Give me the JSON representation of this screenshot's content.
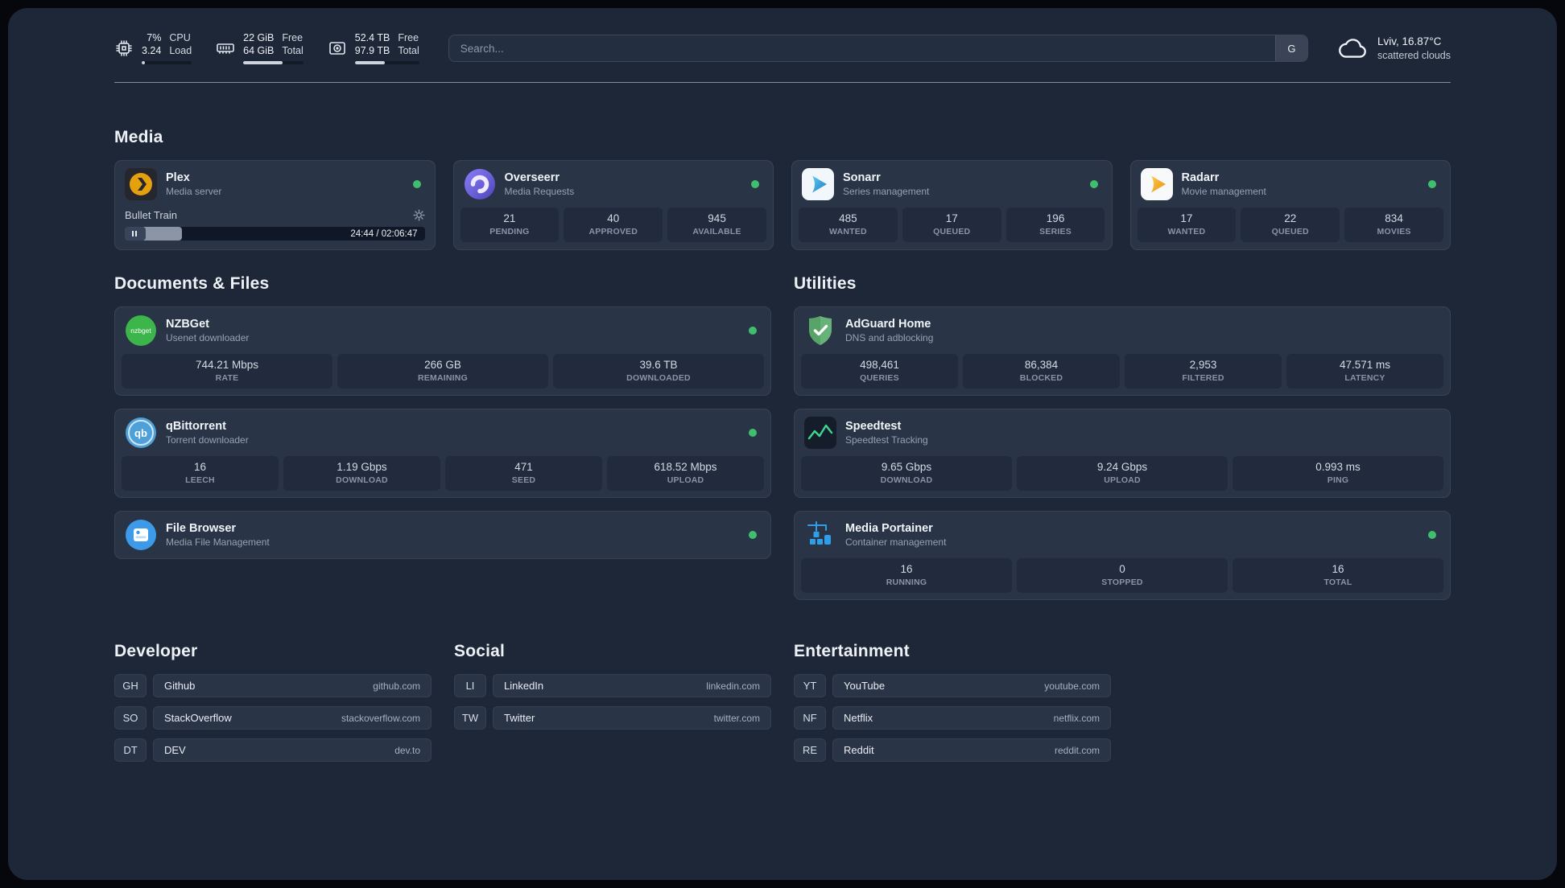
{
  "colors": {
    "status_online": "#3fbf6e",
    "accent_fill": "#cdd4de"
  },
  "topbar": {
    "cpu": {
      "icon": "cpu-icon",
      "values": [
        "7%",
        "3.24"
      ],
      "labels": [
        "CPU",
        "Load"
      ],
      "progress_pct": 7
    },
    "memory": {
      "icon": "memory-icon",
      "values": [
        "22 GiB",
        "64 GiB"
      ],
      "labels": [
        "Free",
        "Total"
      ],
      "progress_pct": 66
    },
    "disk": {
      "icon": "disk-icon",
      "values": [
        "52.4 TB",
        "97.9 TB"
      ],
      "labels": [
        "Free",
        "Total"
      ],
      "progress_pct": 46
    },
    "search": {
      "placeholder": "Search...",
      "provider_button": "G"
    },
    "weather": {
      "icon": "cloud-icon",
      "location": "Lviv, 16.87°C",
      "condition": "scattered clouds"
    }
  },
  "media": {
    "title": "Media",
    "plex": {
      "name": "Plex",
      "desc": "Media server",
      "player": {
        "track": "Bullet Train",
        "time": "24:44 / 02:06:47",
        "progress_pct": 19
      }
    },
    "overseerr": {
      "name": "Overseerr",
      "desc": "Media Requests",
      "stats": [
        {
          "value": "21",
          "label": "PENDING"
        },
        {
          "value": "40",
          "label": "APPROVED"
        },
        {
          "value": "945",
          "label": "AVAILABLE"
        }
      ]
    },
    "sonarr": {
      "name": "Sonarr",
      "desc": "Series management",
      "stats": [
        {
          "value": "485",
          "label": "WANTED"
        },
        {
          "value": "17",
          "label": "QUEUED"
        },
        {
          "value": "196",
          "label": "SERIES"
        }
      ]
    },
    "radarr": {
      "name": "Radarr",
      "desc": "Movie management",
      "stats": [
        {
          "value": "17",
          "label": "WANTED"
        },
        {
          "value": "22",
          "label": "QUEUED"
        },
        {
          "value": "834",
          "label": "MOVIES"
        }
      ]
    }
  },
  "documents": {
    "title": "Documents & Files",
    "nzbget": {
      "name": "NZBGet",
      "desc": "Usenet downloader",
      "stats": [
        {
          "value": "744.21 Mbps",
          "label": "RATE"
        },
        {
          "value": "266 GB",
          "label": "REMAINING"
        },
        {
          "value": "39.6 TB",
          "label": "DOWNLOADED"
        }
      ]
    },
    "qbittorrent": {
      "name": "qBittorrent",
      "desc": "Torrent downloader",
      "stats": [
        {
          "value": "16",
          "label": "LEECH"
        },
        {
          "value": "1.19 Gbps",
          "label": "DOWNLOAD"
        },
        {
          "value": "471",
          "label": "SEED"
        },
        {
          "value": "618.52 Mbps",
          "label": "UPLOAD"
        }
      ]
    },
    "filebrowser": {
      "name": "File Browser",
      "desc": "Media File Management"
    }
  },
  "utilities": {
    "title": "Utilities",
    "adguard": {
      "name": "AdGuard Home",
      "desc": "DNS and adblocking",
      "stats": [
        {
          "value": "498,461",
          "label": "QUERIES"
        },
        {
          "value": "86,384",
          "label": "BLOCKED"
        },
        {
          "value": "2,953",
          "label": "FILTERED"
        },
        {
          "value": "47.571 ms",
          "label": "LATENCY"
        }
      ]
    },
    "speedtest": {
      "name": "Speedtest",
      "desc": "Speedtest Tracking",
      "stats": [
        {
          "value": "9.65 Gbps",
          "label": "DOWNLOAD"
        },
        {
          "value": "9.24 Gbps",
          "label": "UPLOAD"
        },
        {
          "value": "0.993 ms",
          "label": "PING"
        }
      ]
    },
    "portainer": {
      "name": "Media Portainer",
      "desc": "Container management",
      "stats": [
        {
          "value": "16",
          "label": "RUNNING"
        },
        {
          "value": "0",
          "label": "STOPPED"
        },
        {
          "value": "16",
          "label": "TOTAL"
        }
      ]
    }
  },
  "bookmarks": [
    {
      "title": "Developer",
      "items": [
        {
          "abbr": "GH",
          "name": "Github",
          "url": "github.com"
        },
        {
          "abbr": "SO",
          "name": "StackOverflow",
          "url": "stackoverflow.com"
        },
        {
          "abbr": "DT",
          "name": "DEV",
          "url": "dev.to"
        }
      ]
    },
    {
      "title": "Social",
      "items": [
        {
          "abbr": "LI",
          "name": "LinkedIn",
          "url": "linkedin.com"
        },
        {
          "abbr": "TW",
          "name": "Twitter",
          "url": "twitter.com"
        }
      ]
    },
    {
      "title": "Entertainment",
      "items": [
        {
          "abbr": "YT",
          "name": "YouTube",
          "url": "youtube.com"
        },
        {
          "abbr": "NF",
          "name": "Netflix",
          "url": "netflix.com"
        },
        {
          "abbr": "RE",
          "name": "Reddit",
          "url": "reddit.com"
        }
      ]
    }
  ]
}
